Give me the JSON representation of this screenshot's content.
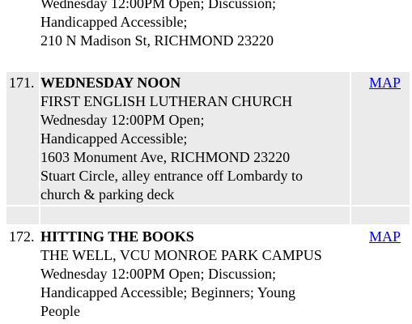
{
  "partial_entry": {
    "schedule": "Wednesday 12:00PM Open; Discussion;",
    "access": "Handicapped Accessible;",
    "address": "210 N Madison St, RICHMOND 23220"
  },
  "meetings": [
    {
      "number": "171.",
      "title": "WEDNESDAY NOON",
      "location": "FIRST ENGLISH LUTHERAN CHURCH",
      "schedule": "Wednesday 12:00PM Open;",
      "access": "Handicapped Accessible;",
      "address": "1603 Monument Ave, RICHMOND 23220",
      "note_line1": "Stuart Circle, alley entrance off Lombardy to",
      "note_line2": "church & parking deck",
      "map_label": "MAP"
    },
    {
      "number": "172.",
      "title": "HITTING THE BOOKS",
      "location": "THE WELL, VCU MONROE PARK CAMPUS",
      "schedule": "Wednesday 12:00PM Open; Discussion;",
      "access_line1": "Handicapped Accessible; Beginners; Young",
      "access_line2": "People",
      "map_label": "MAP"
    }
  ],
  "colors": {
    "row_highlight": "#ebebeb",
    "link": "#0000ee"
  }
}
